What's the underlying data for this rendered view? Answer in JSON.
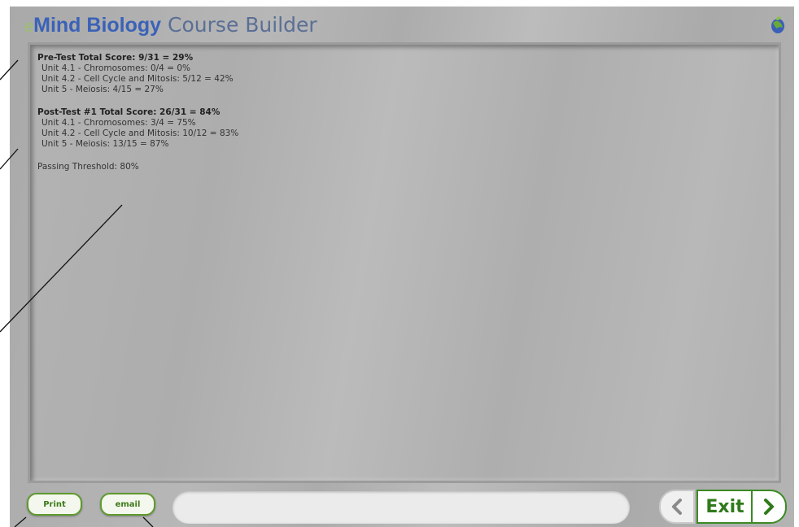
{
  "header": {
    "brand_prefix": "e",
    "brand": "Mind Biology",
    "title": "Course Builder",
    "globe_icon": "globe-icon"
  },
  "report": {
    "pretest": {
      "heading": "Pre-Test Total Score: 9/31 = 29%",
      "units": [
        "Unit 4.1 - Chromosomes: 0/4 = 0%",
        "Unit 4.2 - Cell Cycle and Mitosis: 5/12 = 42%",
        "Unit 5 - Meiosis: 4/15 = 27%"
      ]
    },
    "posttest": {
      "heading": "Post-Test #1 Total Score: 26/31 = 84%",
      "units": [
        "Unit 4.1 - Chromosomes: 3/4 = 75%",
        "Unit 4.2 - Cell Cycle and Mitosis: 10/12 = 83%",
        "Unit 5 - Meiosis: 13/15 = 87%"
      ]
    },
    "threshold": "Passing Threshold: 80%"
  },
  "footer": {
    "print_label": "Print",
    "email_label": "email",
    "message": "",
    "exit_label": "Exit",
    "back_icon": "chevron-left-icon",
    "next_icon": "chevron-right-icon"
  },
  "colors": {
    "accent_green": "#3c8a24",
    "brand_blue": "#3a62b8"
  }
}
